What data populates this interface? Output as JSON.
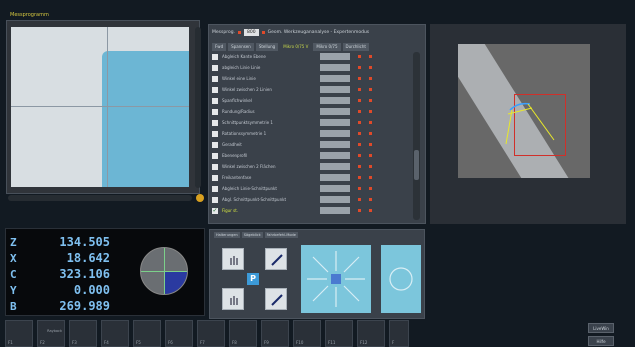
{
  "app": {
    "title": "Messprogramm"
  },
  "measure_panel": {
    "mode_label": "Messprog.",
    "mode_value": "800",
    "mode_desc": "Geom. Werkzeugananalyse - Expertenmodus",
    "tabs": [
      "Fwd",
      "Spannsen",
      "Stellung",
      "Mikro 0/75 V",
      "Mikro 0/75",
      "Durchlicht"
    ],
    "active_tab": 3,
    "rows": [
      {
        "label": "Abgleich Kante Ebene",
        "checked": false
      },
      {
        "label": "abgleich Linie Linie",
        "checked": false
      },
      {
        "label": "Winkel eine Linie",
        "checked": false
      },
      {
        "label": "Winkel zwischen 2 Linien",
        "checked": false
      },
      {
        "label": "Spanflchwinkel",
        "checked": false
      },
      {
        "label": "Rundung/Radius",
        "checked": false
      },
      {
        "label": "Schnittpunktsymmetrie 1",
        "checked": false
      },
      {
        "label": "Rotationssymmetrie 1",
        "checked": false
      },
      {
        "label": "Geradheit",
        "checked": false
      },
      {
        "label": "Ebenenprofil",
        "checked": false
      },
      {
        "label": "Winkel zwischen 2 Flächen",
        "checked": false
      },
      {
        "label": "Freikantenfase",
        "checked": false
      },
      {
        "label": "Abgleich Linie-Schnittpunkt",
        "checked": false
      },
      {
        "label": "Abgl. Schnittpunkt-Schnittpunkt",
        "checked": false
      },
      {
        "label": "Figur st.",
        "checked": true
      }
    ]
  },
  "coordinates": [
    {
      "axis": "Z",
      "value": "134.505"
    },
    {
      "axis": "X",
      "value": "18.642"
    },
    {
      "axis": "C",
      "value": "323.106"
    },
    {
      "axis": "Y",
      "value": "0.000"
    },
    {
      "axis": "B",
      "value": "269.989"
    }
  ],
  "control": {
    "tabs": [
      "Halterungen",
      "Sägeblick",
      "Fahrbefehl-Mode"
    ],
    "p_label": "P"
  },
  "fkeys": [
    "F1",
    "F2",
    "F3",
    "F4",
    "F5",
    "F6",
    "F7",
    "F8",
    "F9",
    "F10",
    "F11",
    "F12",
    "F"
  ],
  "fkey2_sub": "Rayback",
  "side_buttons": [
    "LiveWin",
    "Hilfe"
  ],
  "colors": {
    "accent": "#7fc0f0",
    "active_tab": "#c8d84a",
    "panel": "#3a414a"
  }
}
